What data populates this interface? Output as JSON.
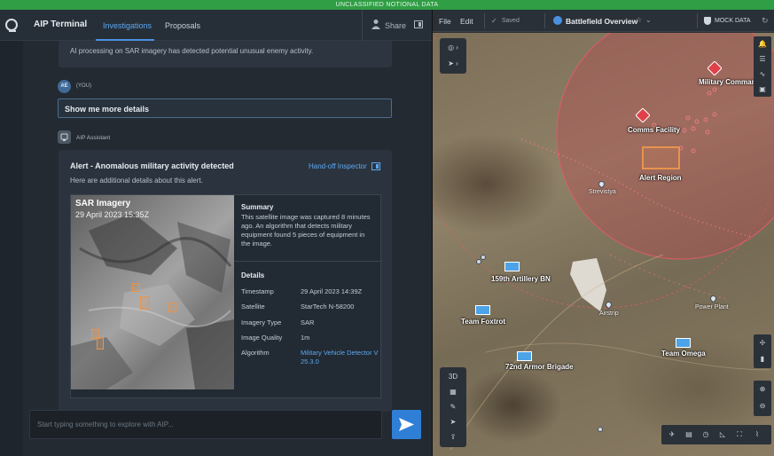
{
  "banner": "UNCLASSIFIED NOTIONAL DATA",
  "app": {
    "title": "AIP Terminal",
    "tabs": [
      "Investigations",
      "Proposals"
    ],
    "share": "Share"
  },
  "chat": {
    "prev_message": "AI processing on SAR imagery has detected potential unusual enemy activity.",
    "user_avatar": "AE",
    "user_label": "(YOU)",
    "user_message": "Show me more details",
    "assistant_label": "AIP Assistant",
    "alert": {
      "title": "Alert - Anomalous military activity detected",
      "handoff": "Hand-off Inspector",
      "subtitle": "Here are additional details about this alert.",
      "image_title": "SAR Imagery",
      "image_date": "29 April 2023 15:35Z",
      "summary_heading": "Summary",
      "summary_text": "This satellite image was captured 8 minutes ago. An algorithm that detects military equipment found 5 pieces of equipment in the image.",
      "details_heading": "Details",
      "details": [
        {
          "key": "Timestamp",
          "value": "29 April 2023 14:39Z"
        },
        {
          "key": "Satellite",
          "value": "StarTech N-58200"
        },
        {
          "key": "Imagery Type",
          "value": "SAR"
        },
        {
          "key": "Image Quality",
          "value": "1m"
        },
        {
          "key": "Algorithm",
          "value": "Military Vehicle Detector V 25.3.0"
        }
      ]
    },
    "input_placeholder": "Start typing something to explore with AIP..."
  },
  "map": {
    "menu": [
      "File",
      "Edit"
    ],
    "saved": "Saved",
    "title": "Battlefield Overview",
    "mock": "MOCK DATA",
    "markers": {
      "military_command": "Military Command",
      "comms": "Comms Facility",
      "alert_region": "Alert Region",
      "artillery": "159th Artillery BN",
      "foxtrot": "Team Foxtrot",
      "armor": "72nd Armor Brigade",
      "omega": "Team Omega"
    },
    "places": {
      "strevistya": "Strevistya",
      "airstrip": "Airstrip",
      "power_plant": "Power Plant"
    },
    "left_tools": [
      "3D"
    ]
  },
  "colors": {
    "accent": "#4a90e2",
    "banner": "#2f9e44",
    "threat": "#e0404a",
    "alert_box": "#e8944d",
    "friendly": "#4da3e8"
  }
}
